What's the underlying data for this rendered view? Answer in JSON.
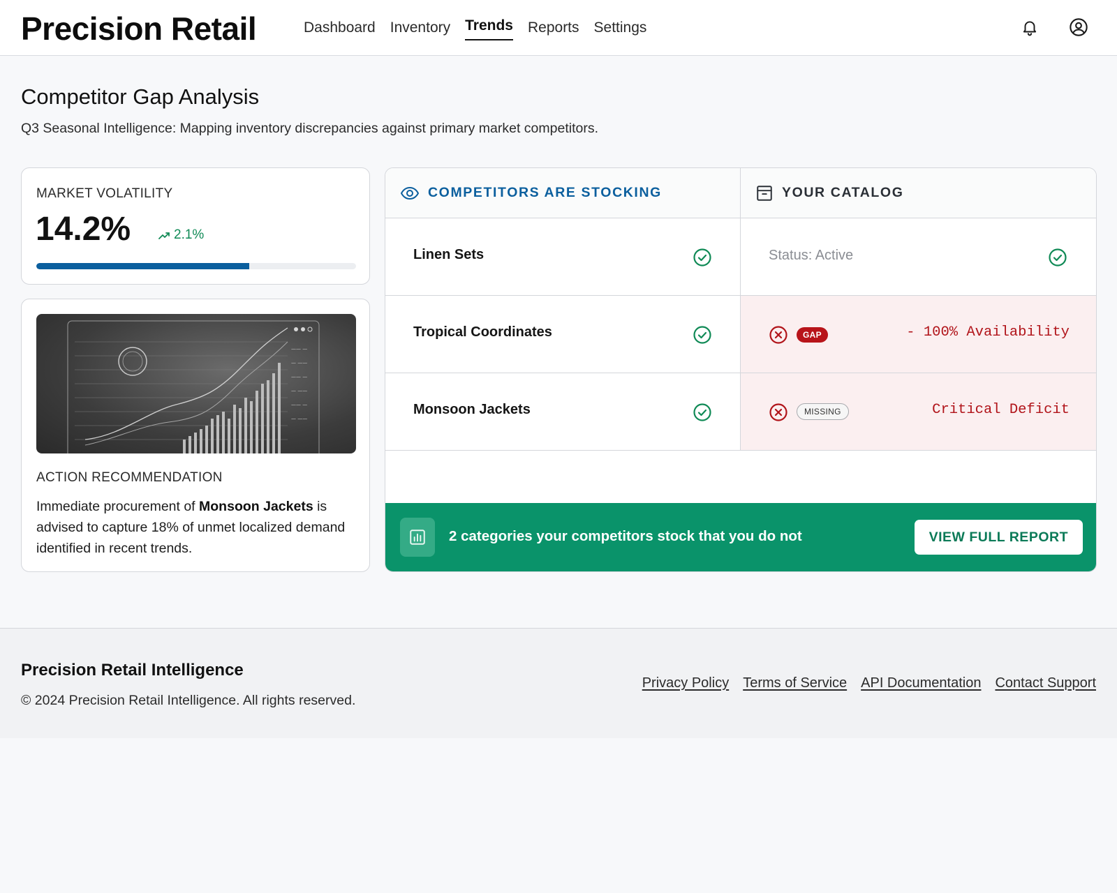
{
  "header": {
    "brand": "Precision Retail",
    "nav": [
      "Dashboard",
      "Inventory",
      "Trends",
      "Reports",
      "Settings"
    ],
    "active_nav": "Trends",
    "icons": [
      "bell-icon",
      "user-circle-icon"
    ]
  },
  "page": {
    "title": "Competitor Gap Analysis",
    "subtitle": "Q3 Seasonal Intelligence: Mapping inventory discrepancies against primary market competitors."
  },
  "volatility": {
    "label": "MARKET VOLATILITY",
    "value": "14.2%",
    "delta": "2.1%",
    "progress_fraction": 0.667,
    "accent": "#0b5f9e"
  },
  "action": {
    "label": "ACTION RECOMMENDATION",
    "text_before": "Immediate procurement of ",
    "highlight": "Monsoon Jackets",
    "text_after": " is advised to capture 18% of unmet localized demand identified in recent trends."
  },
  "comparison": {
    "competitors_heading": "COMPETITORS ARE STOCKING",
    "catalog_heading": "YOUR CATALOG",
    "heading_icons": [
      "eye-icon",
      "archive-box-icon"
    ],
    "rows": [
      {
        "item": "Linen Sets",
        "status": "Status: Active"
      },
      {
        "item": "Tropical Coordinates",
        "badge": "GAP",
        "note": "- 100% Availability"
      },
      {
        "item": "Monsoon Jackets",
        "badge": "MISSING",
        "note": "Critical Deficit"
      }
    ],
    "colors": {
      "ok": "#108a56",
      "gap": "#b1141a",
      "heading_blue": "#0b5f9e"
    }
  },
  "cta": {
    "text": "2 categories your competitors stock that you do not",
    "button": "VIEW FULL REPORT",
    "icon": "bar-chart-icon",
    "color": "#0a936a"
  },
  "footer": {
    "brand": "Precision Retail Intelligence",
    "copyright": "© 2024 Precision Retail Intelligence. All rights reserved.",
    "links": [
      "Privacy Policy",
      "Terms of Service",
      "API Documentation",
      "Contact Support"
    ]
  }
}
